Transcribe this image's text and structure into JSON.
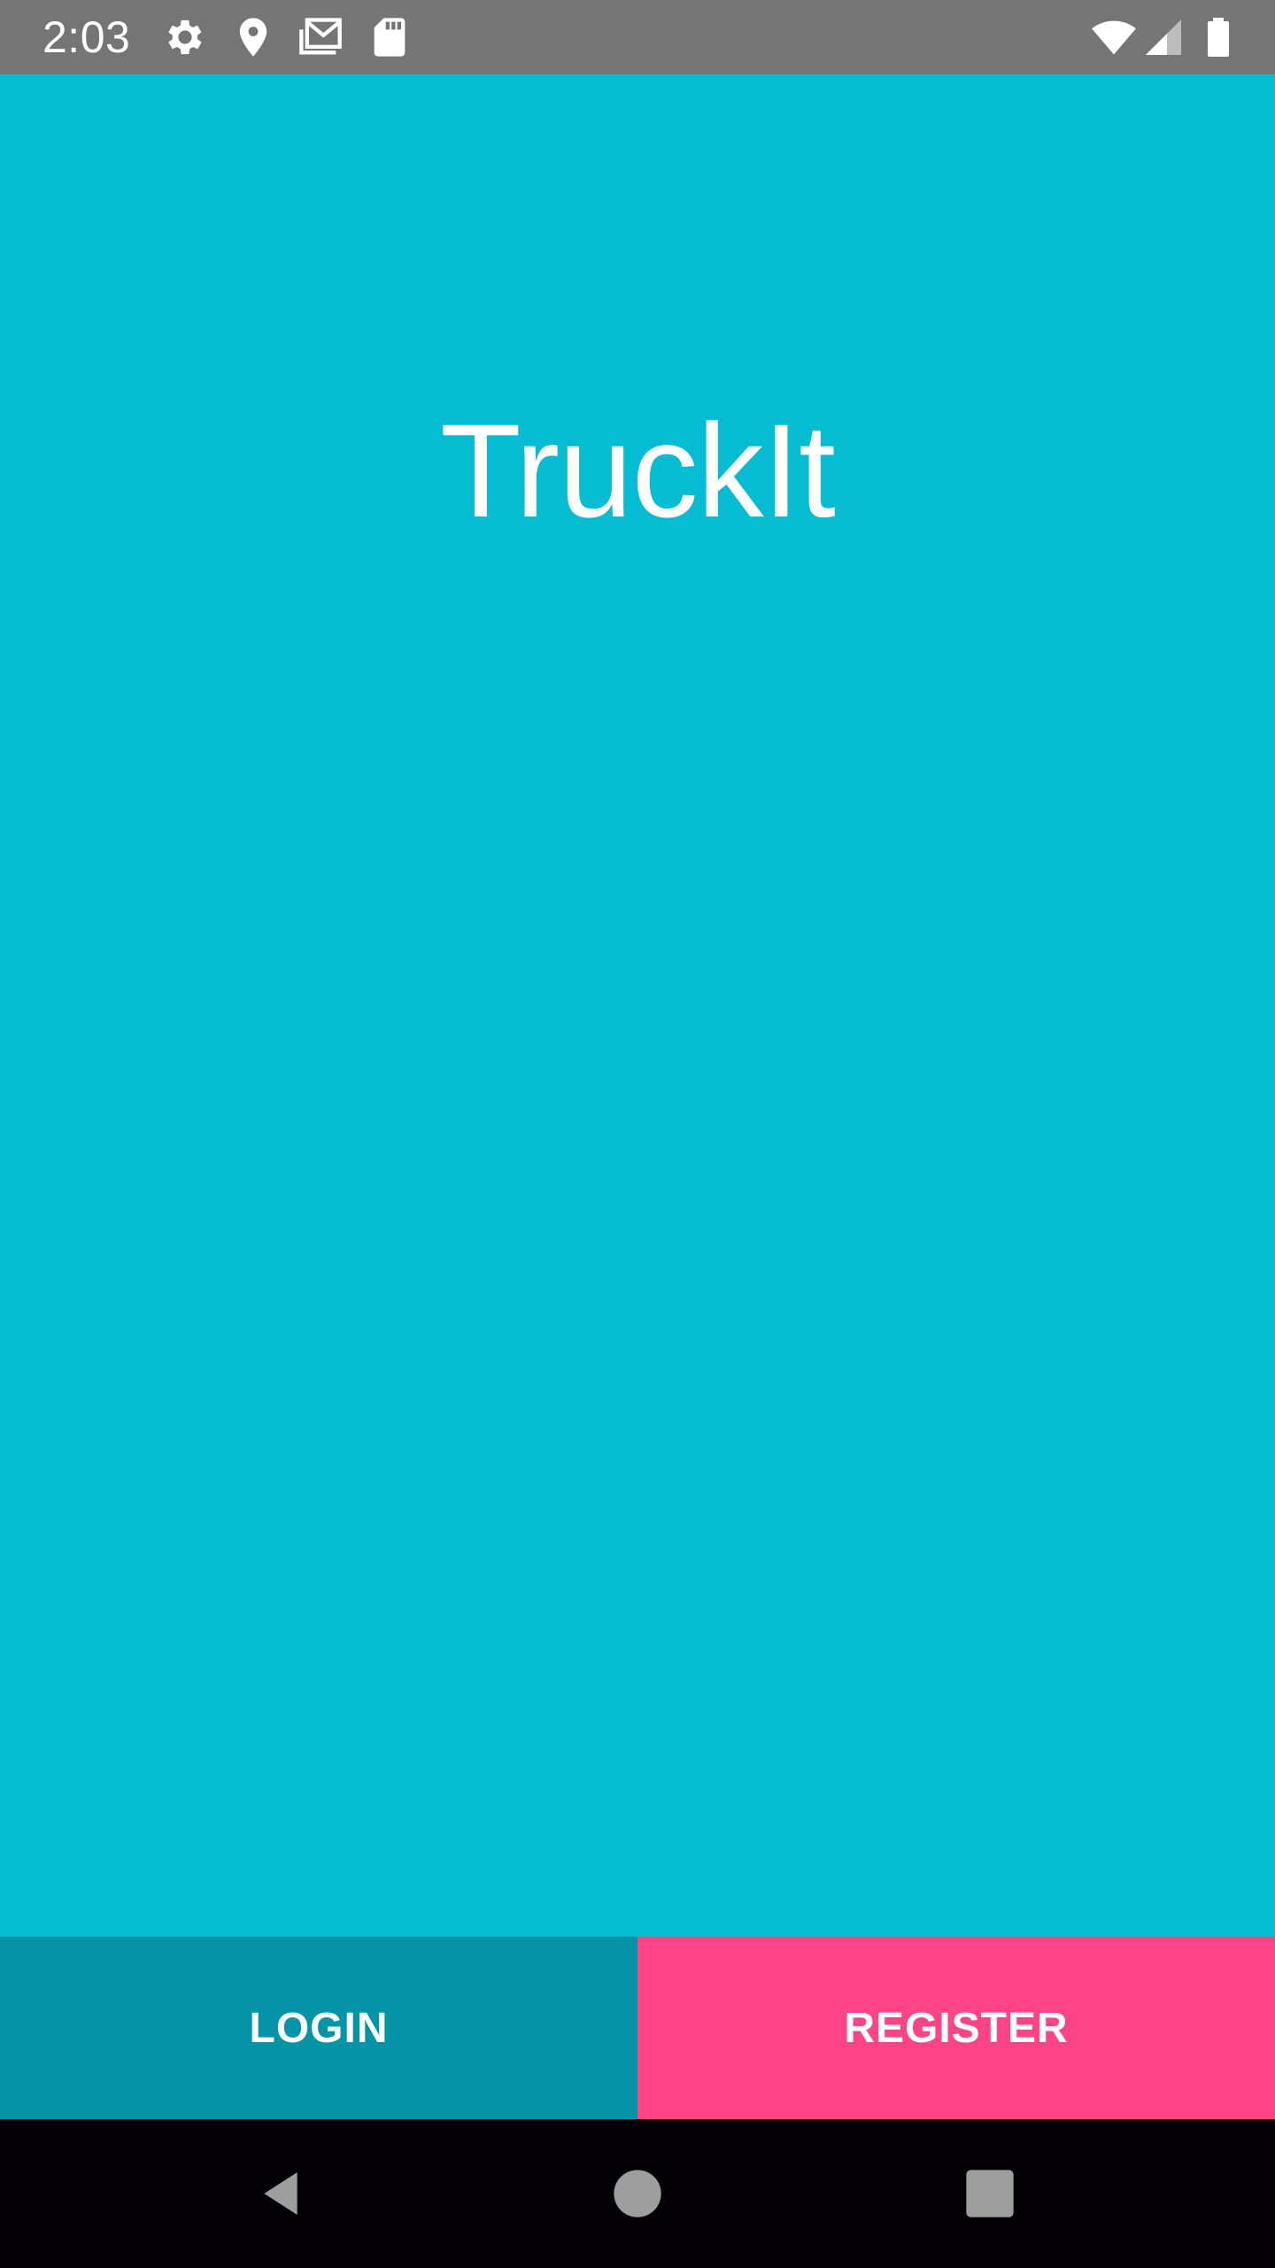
{
  "status_bar": {
    "time": "2:03",
    "left_icons": [
      "gear-icon",
      "location-pin-icon",
      "gmail-icon",
      "sd-card-icon"
    ],
    "right_icons": [
      "wifi-icon",
      "cell-signal-icon",
      "battery-icon"
    ]
  },
  "main": {
    "app_title": "TruckIt",
    "background_color": "#05BCD3"
  },
  "actions": {
    "login_label": "LOGIN",
    "register_label": "REGISTER",
    "login_color": "#0395A7",
    "register_color": "#FF4486"
  },
  "nav_bar": {
    "buttons": [
      "back-icon",
      "home-icon",
      "recents-icon"
    ]
  }
}
